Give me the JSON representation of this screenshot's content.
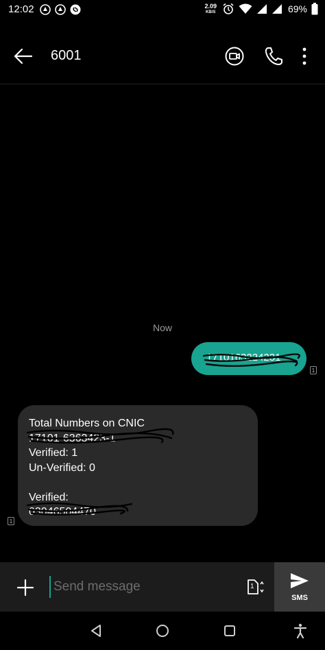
{
  "status_bar": {
    "time": "12:02",
    "net_speed": "2.09",
    "net_speed_unit": "KB/S",
    "battery": "69%"
  },
  "header": {
    "contact": "6001"
  },
  "conversation": {
    "timestamp": "Now",
    "sent_message": "1710163224231",
    "received_message": {
      "lines": [
        "Total Numbers on CNIC",
        "17101-6363423-1",
        "Verified: 1",
        "Un-Verified: 0",
        "",
        "Verified:",
        "03046504470"
      ]
    },
    "sim_badge": "1"
  },
  "composer": {
    "placeholder": "Send message",
    "send_label": "SMS",
    "sim_slot": "1"
  },
  "colors": {
    "accent": "#18a490",
    "sent_bubble": "#18a490",
    "received_bubble": "#2a2a2a",
    "background": "#000000"
  },
  "icons": {
    "back": "arrow-left-icon",
    "video": "video-call-icon",
    "call": "phone-icon",
    "more": "more-vertical-icon",
    "add": "plus-icon",
    "sim": "sim-card-icon",
    "send": "send-icon",
    "nav_back": "triangle-back-icon",
    "nav_home": "circle-home-icon",
    "nav_recents": "square-recents-icon",
    "accessibility": "accessibility-icon"
  }
}
